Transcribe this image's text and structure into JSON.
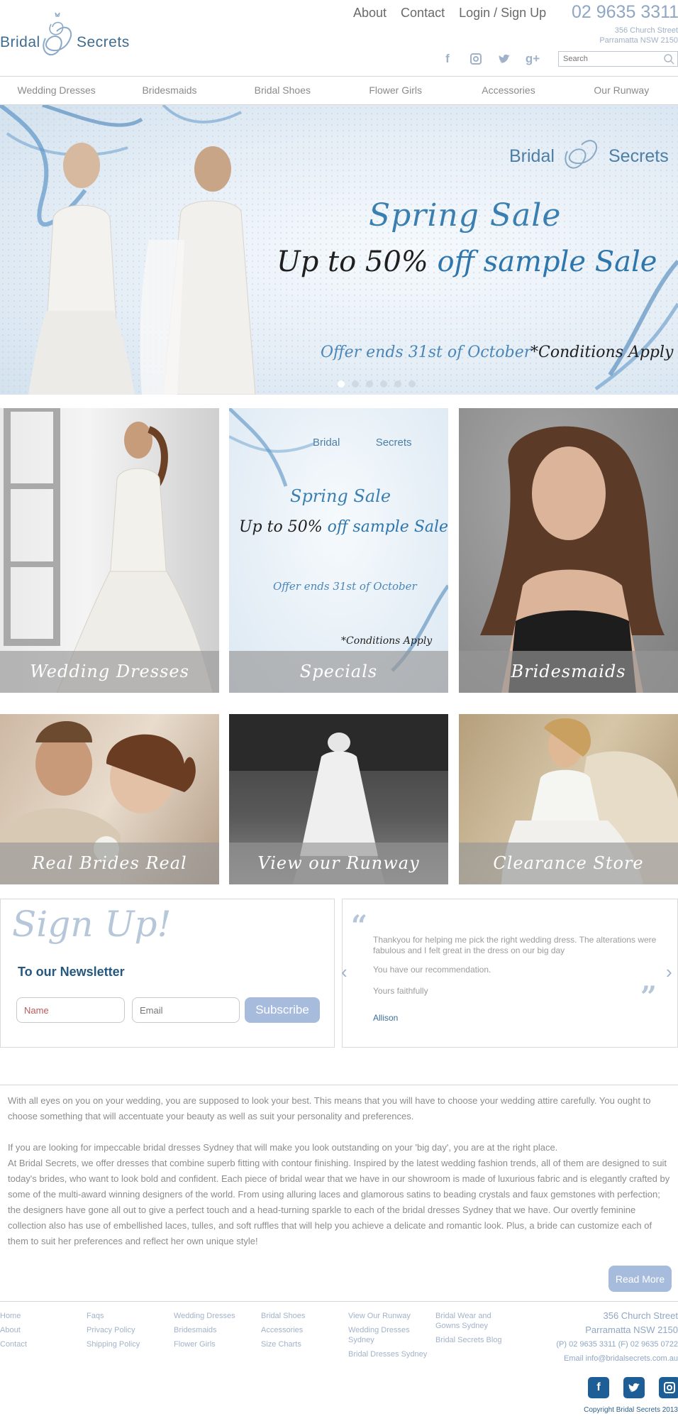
{
  "brand": {
    "word1": "Bridal",
    "word2": "Secrets",
    "monogram": "BS"
  },
  "header": {
    "links": [
      "About",
      "Contact",
      "Login / Sign Up"
    ],
    "phone": "02 9635 3311",
    "address_line1": "356 Church Street",
    "address_line2": "Parramatta NSW 2150",
    "socials": [
      "facebook-icon",
      "instagram-icon",
      "twitter-icon",
      "google-plus-icon"
    ],
    "search_placeholder": "Search"
  },
  "nav": [
    "Wedding Dresses",
    "Bridesmaids",
    "Bridal Shoes",
    "Flower Girls",
    "Accessories",
    "Our Runway"
  ],
  "hero": {
    "title": "Spring Sale",
    "sub_a": "Up to 50% ",
    "sub_b": "off sample Sale",
    "offer": "Offer ends 31st of October",
    "conditions": "*Conditions Apply",
    "slides": 6,
    "active_slide": 1
  },
  "tiles": [
    "Wedding Dresses",
    "Specials",
    "Bridesmaids",
    "Real Brides Real Stories",
    "View our Runway",
    "Clearance Store"
  ],
  "specials_tile": {
    "title": "Spring Sale",
    "sub_a": "Up to 50% ",
    "sub_b": "off sample Sale",
    "offer": "Offer ends 31st of October",
    "conditions": "*Conditions Apply"
  },
  "signup": {
    "heading": "Sign Up!",
    "subheading": "To our Newsletter",
    "name_placeholder": "Name",
    "email_placeholder": "Email",
    "button": "Subscribe"
  },
  "testimonial": {
    "line1": "Thankyou for helping me pick the right wedding dress. The alterations were fabulous and I felt great in the dress on our big day",
    "line2": "You have our recommendation.",
    "line3": "Yours faithfully",
    "author": "Allison"
  },
  "body": {
    "p1": "With all eyes on you on your wedding, you are supposed to look your best. This means that you will have to choose your wedding attire carefully. You ought to choose something that will accentuate your beauty as well as suit your personality and preferences.",
    "p2": "If you are looking for impeccable bridal dresses Sydney that will make you look outstanding on your 'big day', you are at the right place.",
    "p3": "At Bridal Secrets, we offer dresses that combine superb fitting with contour finishing. Inspired by the latest wedding fashion trends, all of them are designed to suit today's brides, who want to look bold and confident. Each piece of bridal wear that we have in our showroom is made of luxurious fabric and is elegantly crafted by some of the multi-award winning designers of the world. From using alluring laces and glamorous satins to beading crystals and faux gemstones with perfection; the designers have gone all out to give a perfect touch and a head-turning sparkle to each of the bridal dresses Sydney that we have. Our overtly feminine collection also has use of embellished laces, tulles, and soft ruffles that will help you achieve a delicate and romantic look. Plus, a bride can customize each of them to suit her preferences and reflect her own unique style!",
    "read_more": "Read More"
  },
  "footer": {
    "col1": [
      "Home",
      "About",
      "Contact"
    ],
    "col2": [
      "Faqs",
      "Privacy Policy",
      "Shipping Policy"
    ],
    "col3": [
      "Wedding Dresses",
      "Bridesmaids",
      "Flower Girls"
    ],
    "col4": [
      "Bridal Shoes",
      "Accessories",
      "Size Charts"
    ],
    "col5": [
      "View Our Runway",
      "Wedding Dresses Sydney",
      "Bridal Dresses Sydney"
    ],
    "col6": [
      "Bridal Wear and Gowns Sydney",
      "Bridal Secrets Blog"
    ],
    "address_line1": "356 Church Street",
    "address_line2": "Parramatta NSW 2150",
    "phones": "(P) 02 9635 3311   (F) 02 9635 0722",
    "email": "Email info@bridalsecrets.com.au",
    "socials": [
      "facebook-icon",
      "twitter-icon",
      "instagram-icon"
    ],
    "copyright": "Copyright Bridal Secrets 2013"
  }
}
